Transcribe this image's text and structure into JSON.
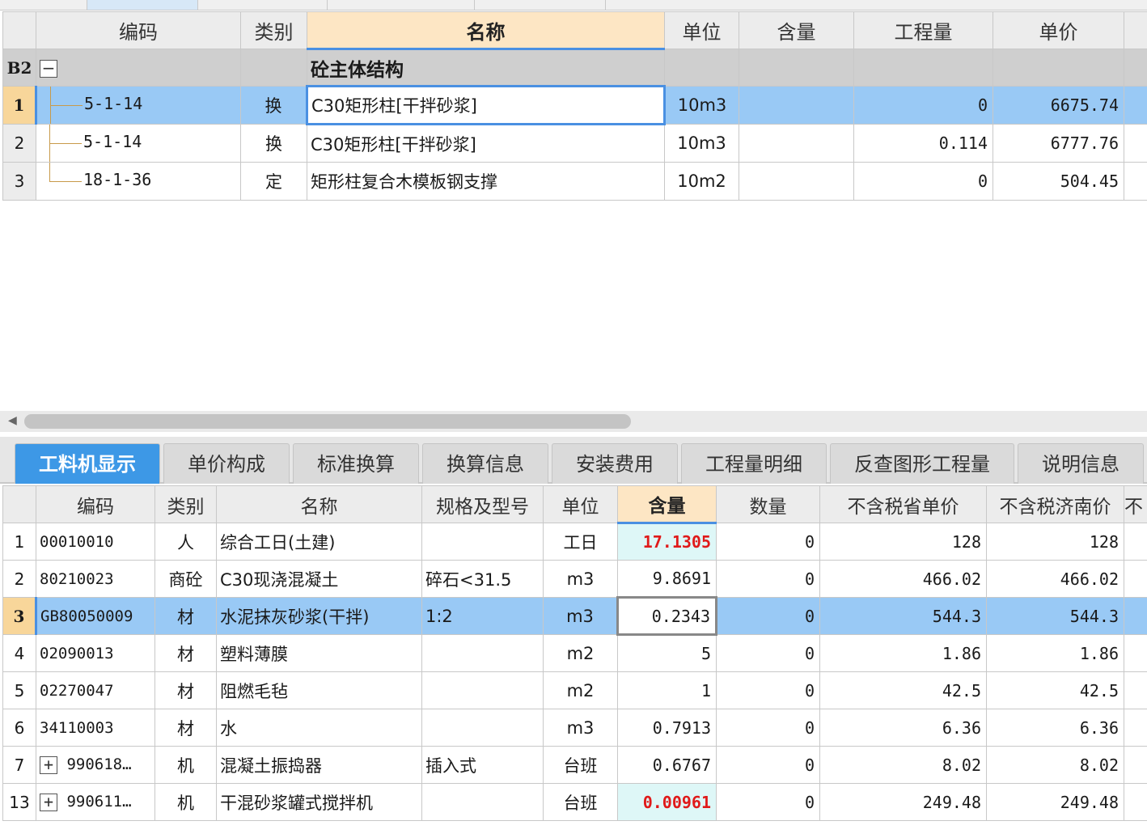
{
  "upper_grid": {
    "columns": [
      "编码",
      "类别",
      "名称",
      "单位",
      "含量",
      "工程量",
      "单价"
    ],
    "group": {
      "row_label": "B2",
      "expander": "−",
      "name": "砼主体结构"
    },
    "rows": [
      {
        "num": "1",
        "code": "5-1-14",
        "type": "换",
        "name": "C30矩形柱[干拌砂浆]",
        "unit": "10m3",
        "content": "",
        "quantity": "0",
        "price": "6675.74"
      },
      {
        "num": "2",
        "code": "5-1-14",
        "type": "换",
        "name": "C30矩形柱[干拌砂浆]",
        "unit": "10m3",
        "content": "",
        "quantity": "0.114",
        "price": "6777.76"
      },
      {
        "num": "3",
        "code": "18-1-36",
        "type": "定",
        "name": "矩形柱复合木模板钢支撑",
        "unit": "10m2",
        "content": "",
        "quantity": "0",
        "price": "504.45"
      }
    ]
  },
  "tabs": [
    "工料机显示",
    "单价构成",
    "标准换算",
    "换算信息",
    "安装费用",
    "工程量明细",
    "反查图形工程量",
    "说明信息"
  ],
  "lower_grid": {
    "columns": [
      "编码",
      "类别",
      "名称",
      "规格及型号",
      "单位",
      "含量",
      "数量",
      "不含税省单价",
      "不含税济南价",
      "不"
    ],
    "rows": [
      {
        "num": "1",
        "code": "00010010",
        "type": "人",
        "name": "综合工日(土建)",
        "spec": "",
        "unit": "工日",
        "content": "17.1305",
        "qty": "0",
        "prov_price": "128",
        "jn_price": "128"
      },
      {
        "num": "2",
        "code": "80210023",
        "type": "商砼",
        "name": "C30现浇混凝土",
        "spec": "碎石<31.5",
        "unit": "m3",
        "content": "9.8691",
        "qty": "0",
        "prov_price": "466.02",
        "jn_price": "466.02"
      },
      {
        "num": "3",
        "code": "GB80050009",
        "type": "材",
        "name": "水泥抹灰砂浆(干拌)",
        "spec": "1:2",
        "unit": "m3",
        "content": "0.2343",
        "qty": "0",
        "prov_price": "544.3",
        "jn_price": "544.3"
      },
      {
        "num": "4",
        "code": "02090013",
        "type": "材",
        "name": "塑料薄膜",
        "spec": "",
        "unit": "m2",
        "content": "5",
        "qty": "0",
        "prov_price": "1.86",
        "jn_price": "1.86"
      },
      {
        "num": "5",
        "code": "02270047",
        "type": "材",
        "name": "阻燃毛毡",
        "spec": "",
        "unit": "m2",
        "content": "1",
        "qty": "0",
        "prov_price": "42.5",
        "jn_price": "42.5"
      },
      {
        "num": "6",
        "code": "34110003",
        "type": "材",
        "name": "水",
        "spec": "",
        "unit": "m3",
        "content": "0.7913",
        "qty": "0",
        "prov_price": "6.36",
        "jn_price": "6.36"
      },
      {
        "num": "7",
        "expander": "+",
        "code": "990618…",
        "type": "机",
        "name": "混凝土振捣器",
        "spec": "插入式",
        "unit": "台班",
        "content": "0.6767",
        "qty": "0",
        "prov_price": "8.02",
        "jn_price": "8.02"
      },
      {
        "num": "13",
        "expander": "+",
        "code": "990611…",
        "type": "机",
        "name": "干混砂浆罐式搅拌机",
        "spec": "",
        "unit": "台班",
        "content": "0.00961",
        "qty": "0",
        "prov_price": "249.48",
        "jn_price": "249.48"
      }
    ]
  },
  "colors": {
    "selection": "#99c9f5",
    "header_sorted": "#fde6c4",
    "tab_active": "#3d98e6",
    "highlight_text": "#e01a1a",
    "highlight_bg": "#def7f7",
    "group_row": "#cfcfcf"
  }
}
